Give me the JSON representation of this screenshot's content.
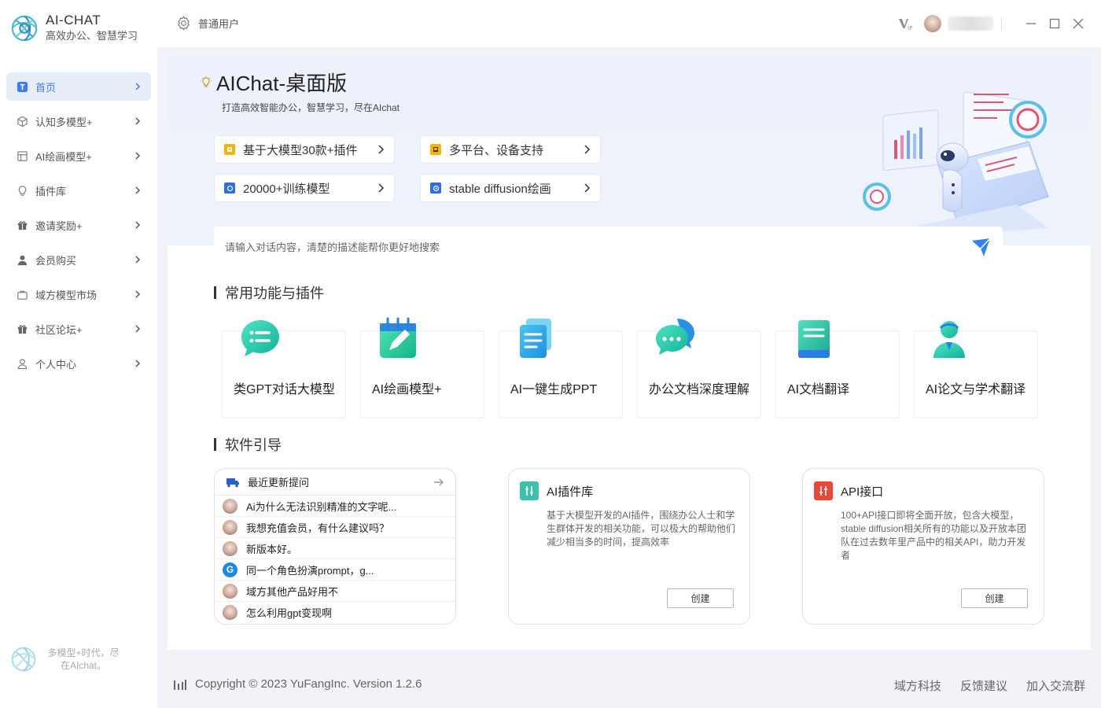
{
  "app": {
    "name": "AI-CHAT",
    "slogan": "高效办公、智慧学习"
  },
  "sidebar": {
    "items": [
      {
        "label": "首页",
        "icon": "home-t-icon",
        "active": true
      },
      {
        "label": "认知多模型+",
        "icon": "cube-icon"
      },
      {
        "label": "AI绘画模型+",
        "icon": "picture-frame-icon"
      },
      {
        "label": "插件库",
        "icon": "bulb-icon"
      },
      {
        "label": "邀请奖励+",
        "icon": "gift-icon"
      },
      {
        "label": "会员购买",
        "icon": "user-icon"
      },
      {
        "label": "域方模型市场",
        "icon": "bag-icon"
      },
      {
        "label": "社区论坛+",
        "icon": "gift-icon"
      },
      {
        "label": "个人中心",
        "icon": "person-outline-icon"
      }
    ],
    "footer_line1": "多模型+时代，尽",
    "footer_line2": "在AIchat。"
  },
  "titlebar": {
    "user_role": "普通用户"
  },
  "hero": {
    "title": "AIChat-桌面版",
    "subtitle": "打造高效智能办公，智慧学习，尽在AIchat",
    "features": [
      {
        "label": "基于大模型30款+插件",
        "color": "#f5b400"
      },
      {
        "label": "多平台、设备支持",
        "color": "#f5b400"
      },
      {
        "label": "20000+训练模型",
        "color": "#2f6fde"
      },
      {
        "label": "stable diffusion绘画",
        "color": "#2f6fde"
      }
    ],
    "search_placeholder": "请输入对话内容，清楚的描述能帮你更好地搜索"
  },
  "tools": {
    "title": "常用功能与插件",
    "items": [
      {
        "label": "类GPT对话大模型",
        "icon": "chat-bubble-icon"
      },
      {
        "label": "AI绘画模型+",
        "icon": "notepad-pen-icon"
      },
      {
        "label": "AI一键生成PPT",
        "icon": "document-icon"
      },
      {
        "label": "办公文档深度理解",
        "icon": "speech-bubbles-icon"
      },
      {
        "label": "AI文档翻译",
        "icon": "book-icon"
      },
      {
        "label": "AI论文与学术翻译",
        "icon": "scholar-icon"
      }
    ]
  },
  "guide": {
    "title": "软件引导",
    "recent": {
      "title": "最近更新提问",
      "questions": [
        {
          "text": "Ai为什么无法识别精准的文字呢...",
          "avatar": "photo"
        },
        {
          "text": "我想充值会员，有什么建议吗？",
          "avatar": "photo"
        },
        {
          "text": "新版本好。",
          "avatar": "photo"
        },
        {
          "text": "同一个角色扮演prompt，g...",
          "avatar": "G"
        },
        {
          "text": "域方其他产品好用不",
          "avatar": "photo"
        },
        {
          "text": "怎么利用gpt变现啊",
          "avatar": "photo"
        }
      ]
    },
    "plugin_card": {
      "title": "AI插件库",
      "desc": "基于大模型开发的AI插件，围绕办公人士和学生群体开发的相关功能，可以极大的帮助他们减少相当多的时间，提高效率",
      "button": "创建",
      "color": "#3cc0a8"
    },
    "api_card": {
      "title": "API接口",
      "desc": "100+API接口即将全面开放，包含大模型，stable diffusion相关所有的功能以及开放本团队在过去数年里产品中的相关API，助力开发者",
      "button": "创建",
      "color": "#e8493b"
    }
  },
  "footer": {
    "copyright": "Copyright © 2023 YuFangInc. Version 1.2.6",
    "links": [
      "域方科技",
      "反馈建议",
      "加入交流群"
    ]
  },
  "colors": {
    "accent": "#3c7cf3",
    "active_bg": "#e8eef9"
  }
}
